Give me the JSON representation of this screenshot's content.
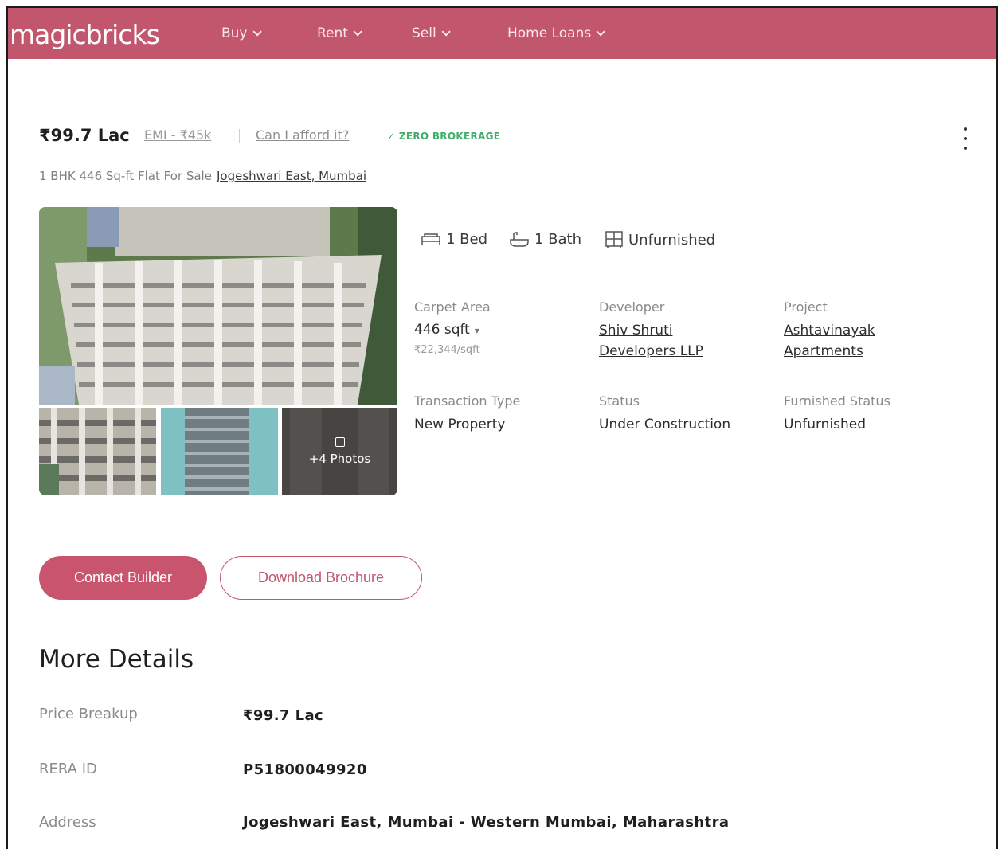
{
  "nav": {
    "logo": "magicbricks",
    "items": [
      {
        "label": "Buy"
      },
      {
        "label": "Rent"
      },
      {
        "label": "Sell"
      },
      {
        "label": "Home Loans"
      }
    ]
  },
  "listing": {
    "price": "₹99.7 Lac",
    "emi": "EMI - ₹45k",
    "afford_link": "Can I afford it?",
    "badge": "ZERO BROKERAGE",
    "subtitle": "1 BHK 446 Sq-ft Flat For Sale",
    "location": "Jogeshwari East, Mumbai"
  },
  "gallery": {
    "more_photos": "+4 Photos"
  },
  "features": {
    "bed": "1 Bed",
    "bath": "1 Bath",
    "furnish": "Unfurnished"
  },
  "specs": {
    "carpet_area": {
      "label": "Carpet Area",
      "value": "446 sqft",
      "rate": "₹22,344/sqft"
    },
    "developer": {
      "label": "Developer",
      "line1": "Shiv Shruti",
      "line2": "Developers LLP"
    },
    "project": {
      "label": "Project",
      "line1": "Ashtavinayak",
      "line2": "Apartments"
    },
    "transaction": {
      "label": "Transaction Type",
      "value": "New Property"
    },
    "status": {
      "label": "Status",
      "value": "Under Construction"
    },
    "furnished": {
      "label": "Furnished Status",
      "value": "Unfurnished"
    }
  },
  "actions": {
    "contact": "Contact Builder",
    "brochure": "Download Brochure"
  },
  "more_details": {
    "title": "More Details",
    "rows": [
      {
        "label": "Price Breakup",
        "value": "₹99.7 Lac"
      },
      {
        "label": "RERA ID",
        "value": "P51800049920"
      },
      {
        "label": "Address",
        "value": "Jogeshwari East, Mumbai - Western Mumbai, Maharashtra"
      }
    ]
  },
  "colors": {
    "brand": "#c2566c",
    "badge_green": "#3fae6a"
  }
}
